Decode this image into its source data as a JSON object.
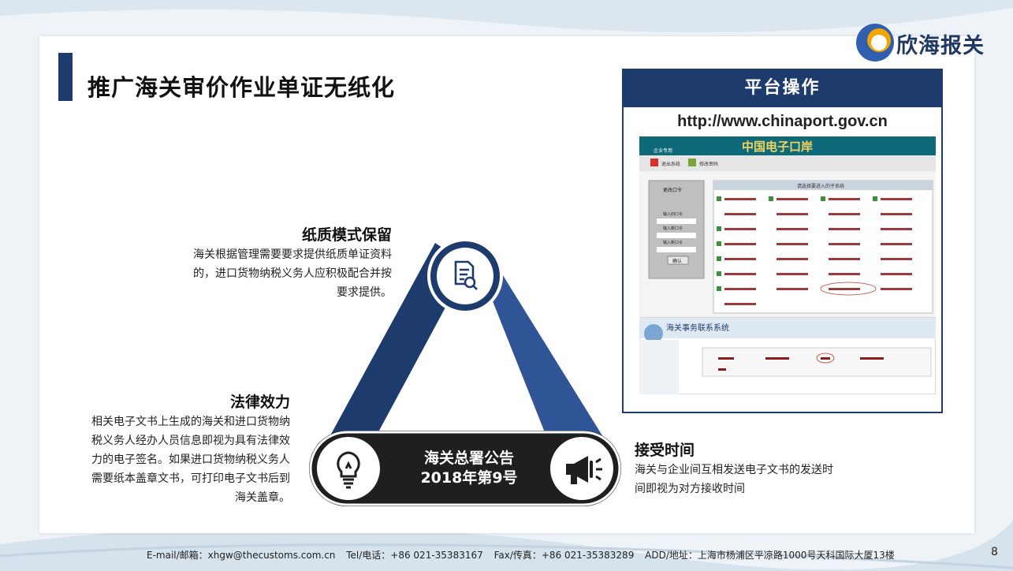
{
  "page": {
    "title": "推广海关审价作业单证无纸化",
    "page_number": "8"
  },
  "logo": {
    "text": "欣海报关"
  },
  "panel": {
    "heading": "平台操作",
    "url": "http://www.chinaport.gov.cn",
    "screenshot": {
      "banner": "中国电子口岸",
      "section": "企业专用",
      "toolbar_items": [
        "退出系统",
        "修改密码"
      ],
      "login_title": "更改口令",
      "login_labels": [
        "输入旧口令",
        "输入新口令",
        "输入新口令"
      ],
      "confirm_label": "确认",
      "grid_title": "请选择要进入的子系统",
      "system_title": "海关事务联系系统"
    }
  },
  "sections": {
    "paper": {
      "heading": "纸质模式保留",
      "lines": [
        "海关根据管理需要要求提供纸质单证资料",
        "的，进口货物纳税义务人应积极配合并按",
        "要求提供。"
      ]
    },
    "legal": {
      "heading": "法律效力",
      "lines": [
        "相关电子文书上生成的海关和进口货物纳",
        "税义务人经办人员信息即视为具有法律效",
        "力的电子签名。如果进口货物纳税义务人",
        "需要纸本盖章文书，可打印电子文书后到",
        "海关盖章。"
      ]
    },
    "receive": {
      "heading": "接受时间",
      "lines": [
        "海关与企业间互相发送电子文书的发送时",
        "间即视为对方接收时间"
      ]
    }
  },
  "diagram": {
    "center_line1": "海关总署公告",
    "center_line2": "2018年第9号",
    "icons": [
      "document-search-icon",
      "lightbulb-icon",
      "megaphone-icon"
    ]
  },
  "footer": {
    "email": "E-mail/邮箱：xhgw@thecustoms.com.cn",
    "tel": "Tel/电话：+86 021-35383167",
    "fax": "Fax/传真：+86 021-35383289",
    "address": "ADD/地址：上海市杨浦区平凉路1000号天科国际大厦13楼"
  },
  "colors": {
    "navy": "#1e3b6e",
    "blue": "#2f5597",
    "dark": "#1f1f1f"
  }
}
